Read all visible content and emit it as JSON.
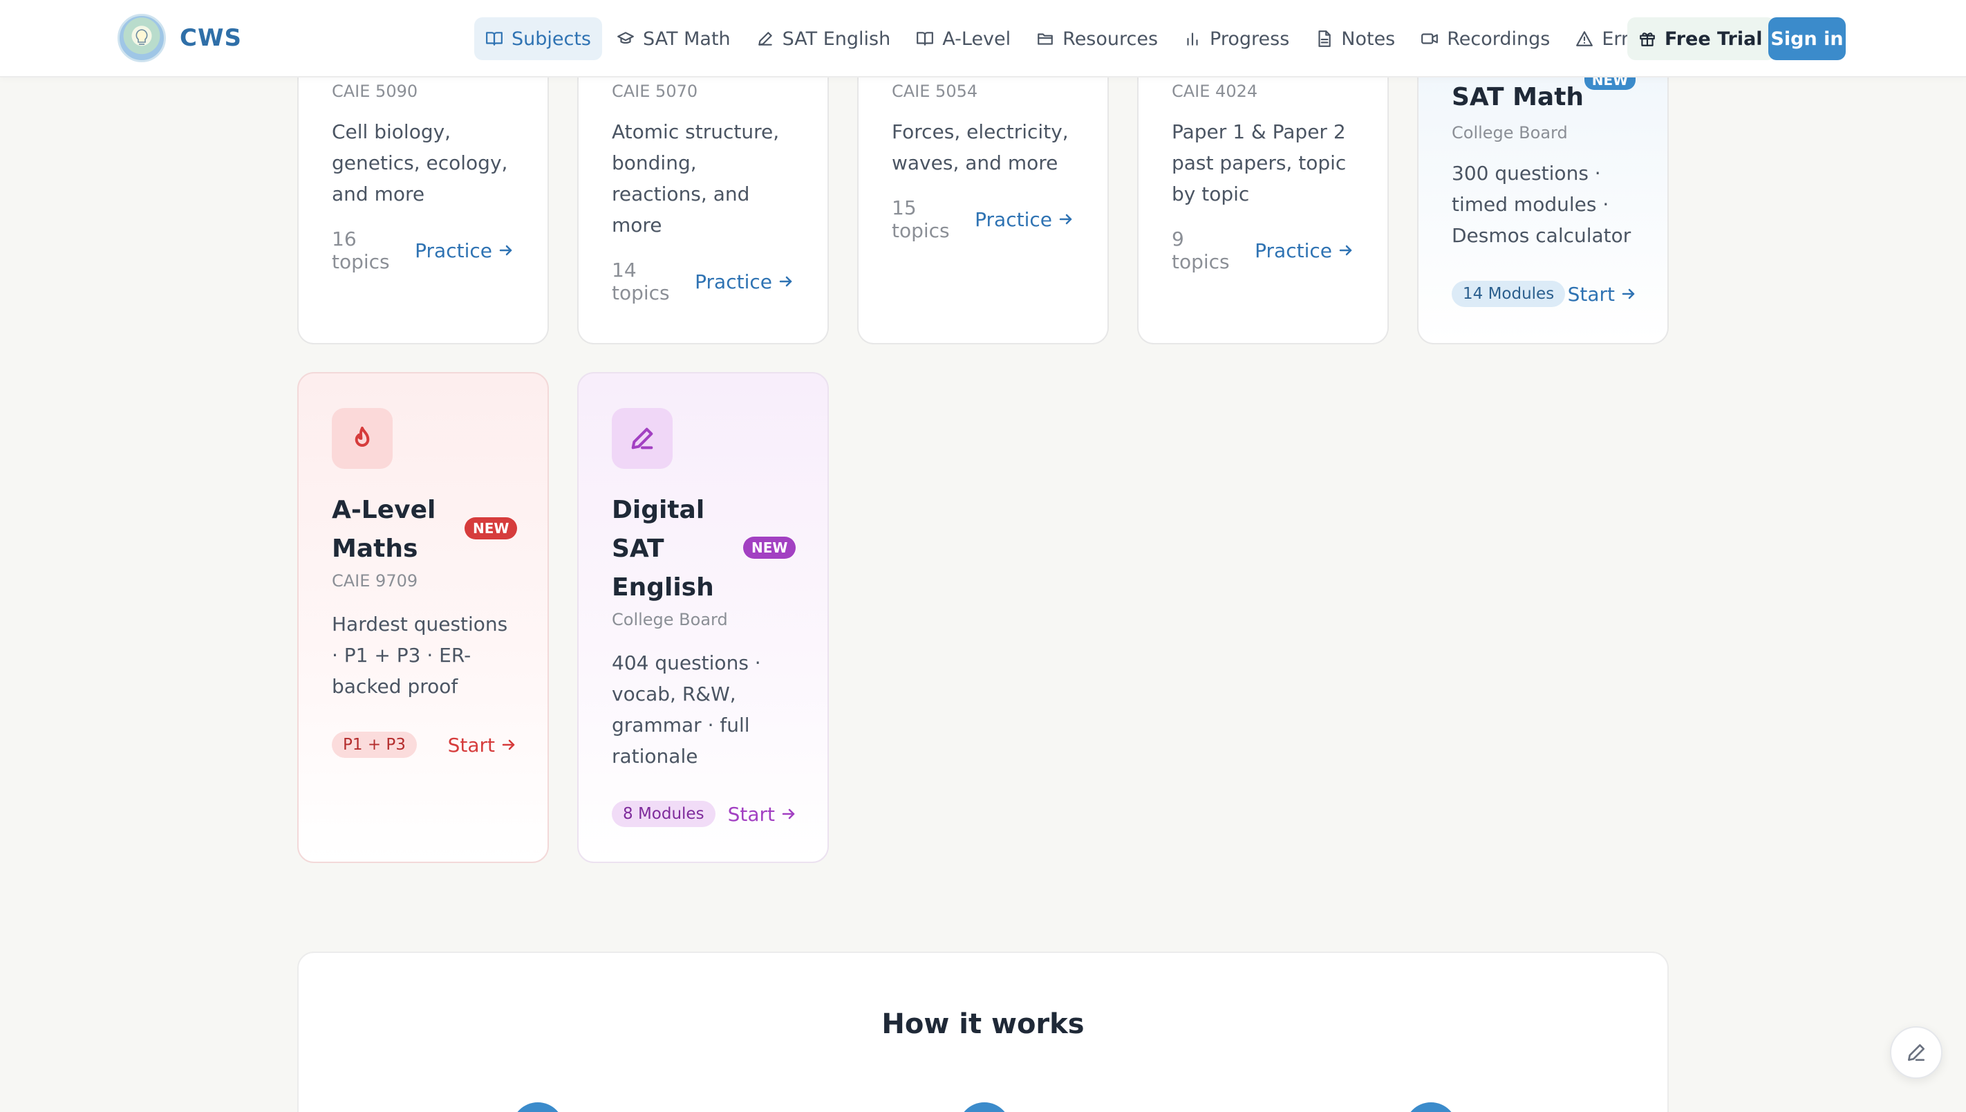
{
  "brand": {
    "name": "CWS"
  },
  "nav": {
    "items": [
      {
        "label": "Subjects",
        "icon": "book-open-icon",
        "active": true
      },
      {
        "label": "SAT Math",
        "icon": "graduation-cap-icon"
      },
      {
        "label": "SAT English",
        "icon": "pen-icon"
      },
      {
        "label": "A-Level",
        "icon": "book-open-icon"
      },
      {
        "label": "Resources",
        "icon": "folder-icon"
      },
      {
        "label": "Progress",
        "icon": "bar-chart-icon"
      },
      {
        "label": "Notes",
        "icon": "file-text-icon"
      },
      {
        "label": "Recordings",
        "icon": "video-icon"
      },
      {
        "label": "Error Log",
        "icon": "alert-triangle-icon"
      }
    ],
    "free_trial": "Free Trial",
    "sign_in": "Sign in"
  },
  "subject_cards": [
    {
      "code": "CAIE 5090",
      "description": "Cell biology, genetics, ecology, and more",
      "topics": "16 topics",
      "action": "Practice"
    },
    {
      "code": "CAIE 5070",
      "description": "Atomic structure, bonding, reactions, and more",
      "topics": "14 topics",
      "action": "Practice"
    },
    {
      "code": "CAIE 5054",
      "description": "Forces, electricity, waves, and more",
      "topics": "15 topics",
      "action": "Practice"
    },
    {
      "code": "CAIE 4024",
      "description": "Paper 1 & Paper 2 past papers, topic by topic",
      "topics": "9 topics",
      "action": "Practice"
    }
  ],
  "sat_math": {
    "badge": "NEW",
    "title": "SAT Math",
    "board": "College Board",
    "description": "300 questions · timed modules · Desmos calculator",
    "pill": "14 Modules",
    "action": "Start"
  },
  "alevel": {
    "title_line1": "A-Level",
    "title_line2": "Maths",
    "badge": "NEW",
    "code": "CAIE 9709",
    "description": "Hardest questions · P1 + P3 · ER-backed proof",
    "pill": "P1 + P3",
    "action": "Start",
    "icon": "flame-icon",
    "accent": "#d63c3c"
  },
  "sat_english": {
    "title_line1": "Digital",
    "title_line2": "SAT",
    "title_line3": "English",
    "badge": "NEW",
    "board": "College Board",
    "description": "404 questions · vocab, R&W, grammar · full rationale",
    "pill": "8 Modules",
    "action": "Start",
    "icon": "pen-line-icon",
    "accent": "#a240c2"
  },
  "how_it_works": {
    "title": "How it works"
  },
  "colors": {
    "primary": "#3b8bcb",
    "nav_active_bg": "#e8f1f8",
    "page_bg": "#f7f7f4"
  }
}
